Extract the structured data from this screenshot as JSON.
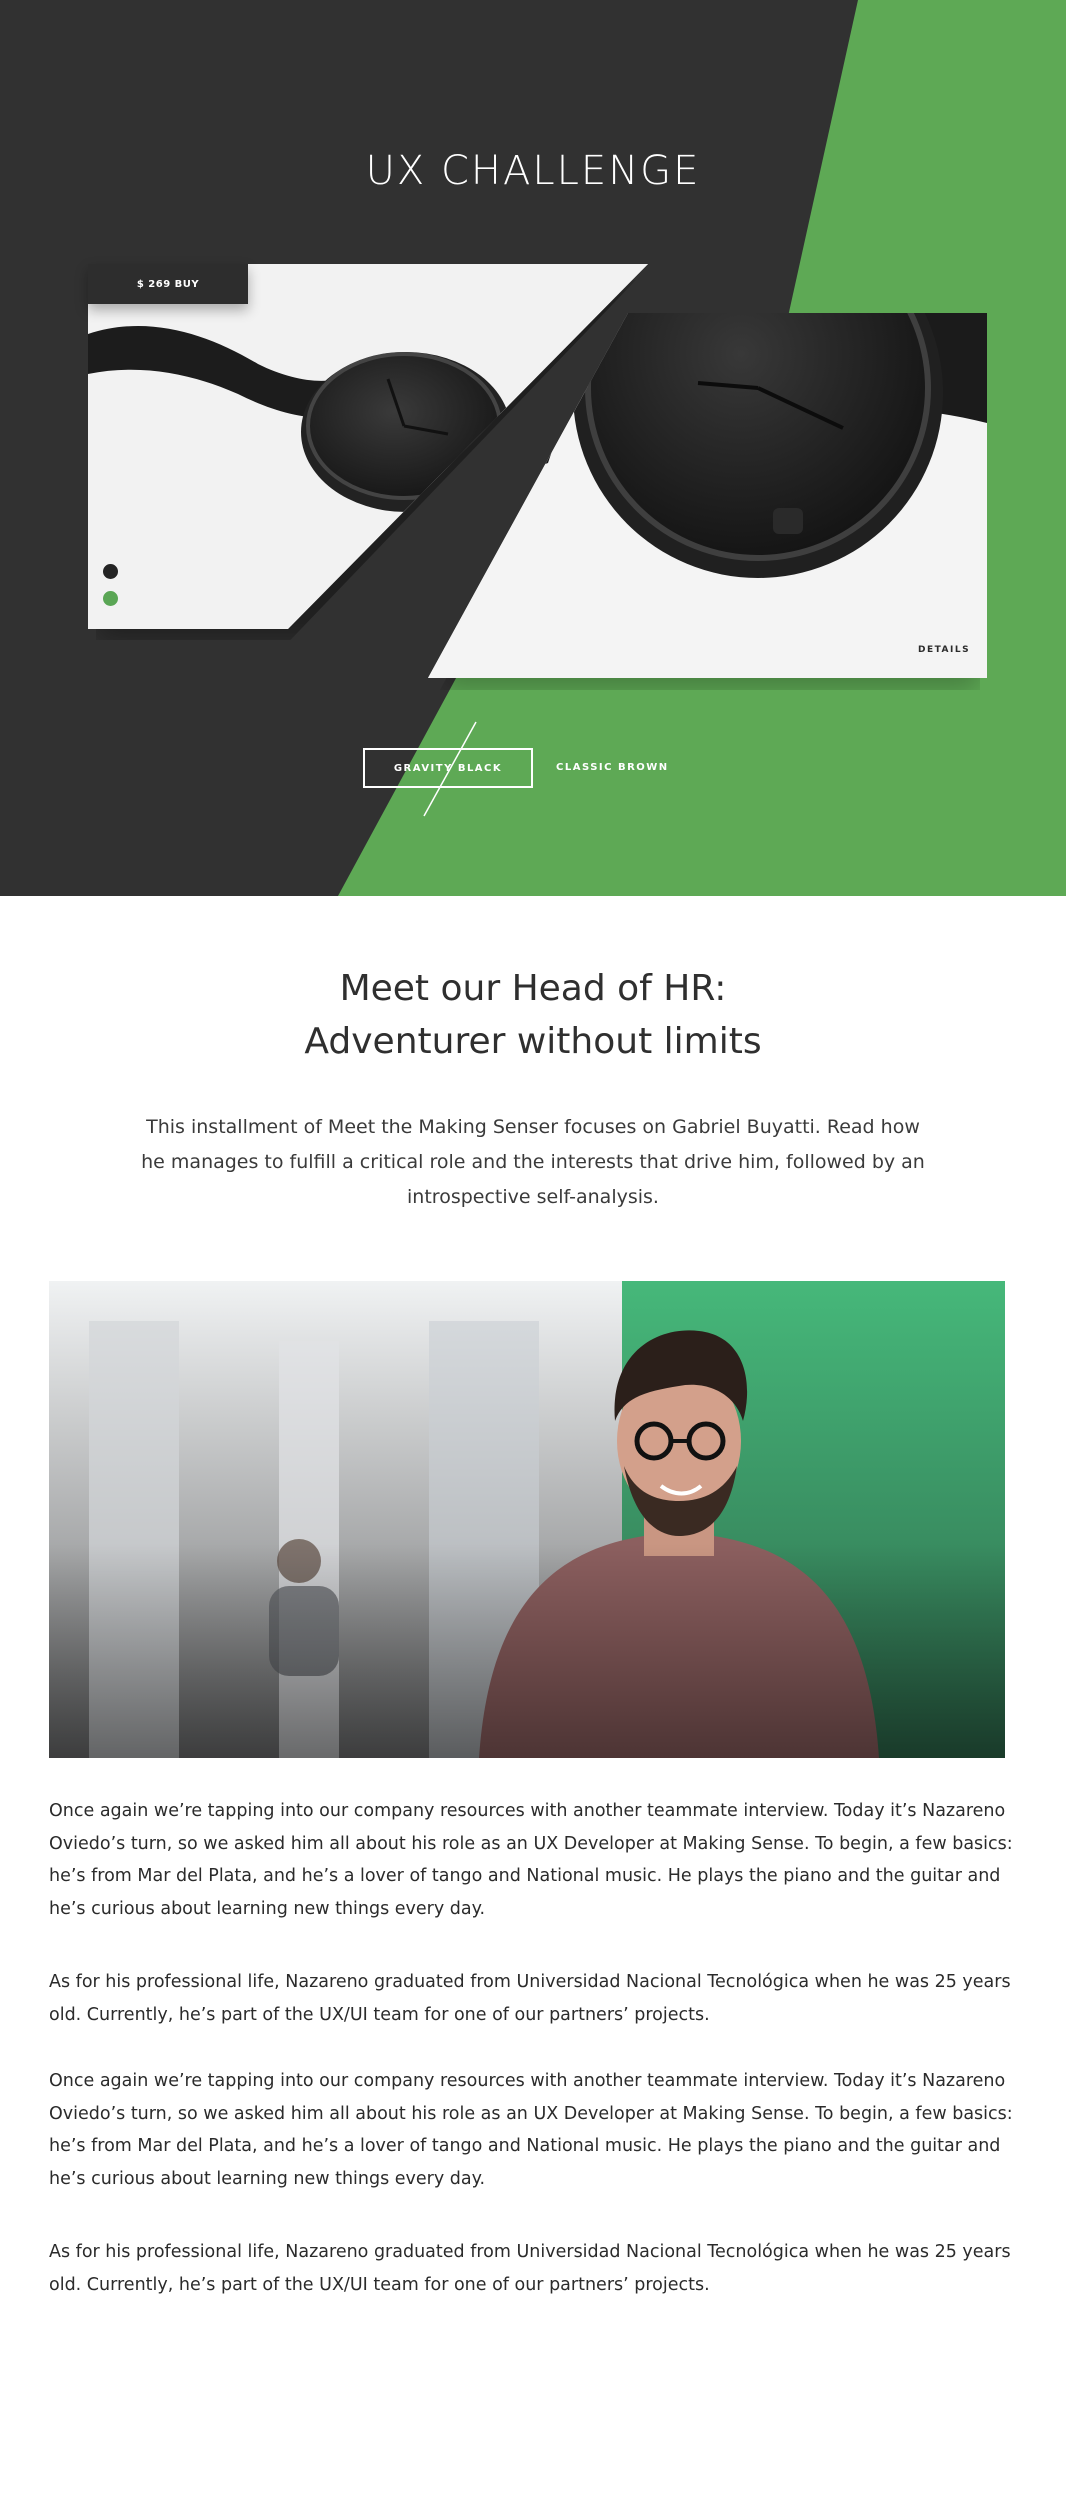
{
  "colors": {
    "dark": "#313131",
    "accent_green": "#5ea955",
    "white": "#ffffff",
    "text": "#2e2e2e"
  },
  "hero": {
    "title": "UX CHALLENGE",
    "price_badge": "$ 269 BUY",
    "details_label": "DETAILS",
    "variants": [
      "GRAVITY BLACK",
      "CLASSIC BROWN"
    ],
    "selected_variant": "GRAVITY BLACK",
    "carousel_dots": 2,
    "active_dot": 1
  },
  "article": {
    "title_line1": "Meet our Head of HR:",
    "title_line2": "Adventurer without limits",
    "intro": "This installment of Meet the Making Senser focuses on Gabriel Buyatti. Read how he manages to fulfill a critical role and the interests that drive him, followed by an introspective self-analysis.",
    "paragraphs": [
      "Once again we’re tapping into our company resources with another teammate interview. Today it’s Nazareno Oviedo’s turn, so we asked him all about his role as an UX Developer at Making Sense. To begin, a few basics: he’s from Mar del Plata, and he’s a lover of tango and National music. He plays the piano and the guitar and he’s curious about learning new things every day.",
      "As for his professional life, Nazareno graduated from Universidad Nacional Tecnológica when he was 25 years old. Currently, he’s part of the UX/UI team for one of our partners’ projects.",
      "Once again we’re tapping into our company resources with another teammate interview. Today it’s Nazareno Oviedo’s turn, so we asked him all about his role as an UX Developer at Making Sense. To begin, a few basics: he’s from Mar del Plata, and he’s a lover of tango and National music. He plays the piano and the guitar and he’s curious about learning new things every day.",
      "As for his professional life, Nazareno graduated from Universidad Nacional Tecnológica when he was 25 years old. Currently, he’s part of the UX/UI team for one of our partners’ projects."
    ]
  }
}
